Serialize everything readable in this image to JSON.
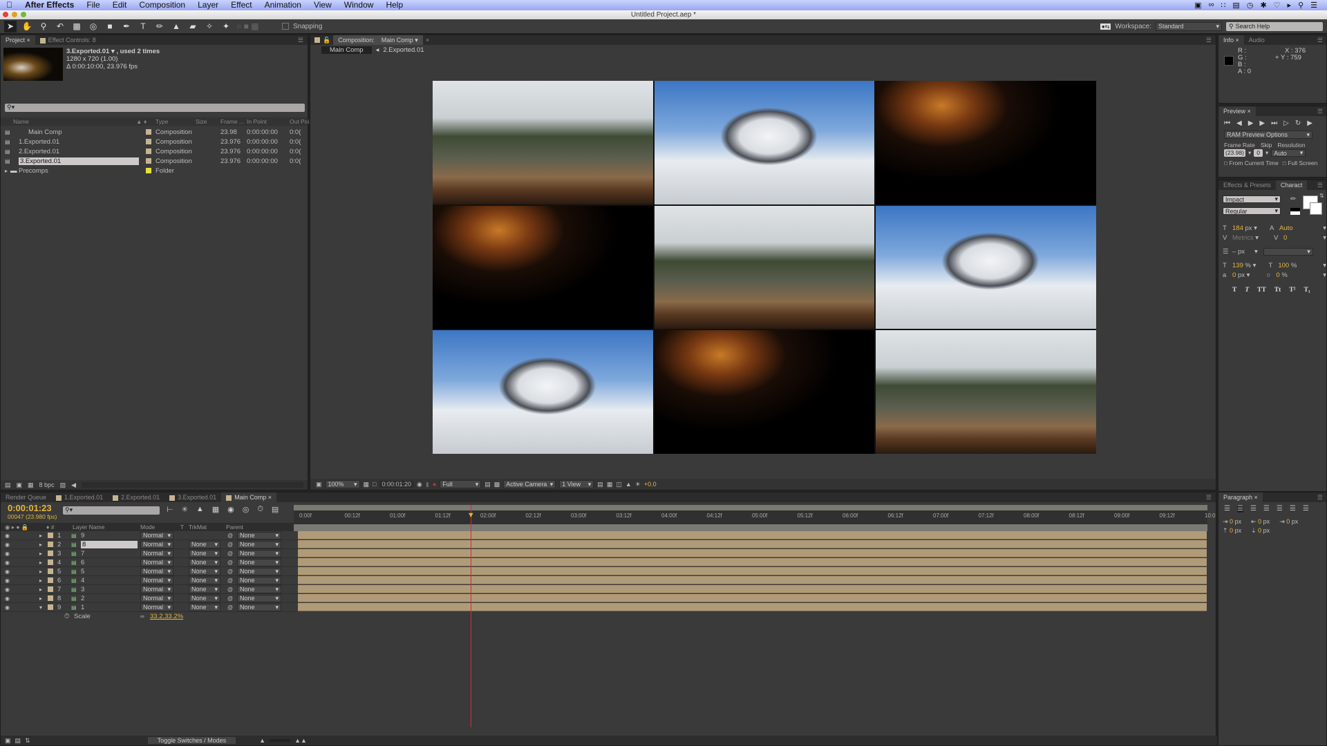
{
  "menubar": {
    "app": "After Effects",
    "items": [
      "File",
      "Edit",
      "Composition",
      "Layer",
      "Effect",
      "Animation",
      "View",
      "Window",
      "Help"
    ],
    "tray_icons": [
      "camera-icon",
      "creative-cloud-icon",
      "grid-icon",
      "folder-check-icon",
      "time-machine-icon",
      "bluetooth-icon",
      "wifi-icon",
      "volume-icon",
      "spotlight-icon",
      "list-icon"
    ]
  },
  "window": {
    "title": "Untitled Project.aep *"
  },
  "toolbar": {
    "snapping_label": "Snapping",
    "workspace_label": "Workspace:",
    "workspace_value": "Standard",
    "search_placeholder": "Search Help"
  },
  "project": {
    "tabs": [
      "Project",
      "Effect Controls: 8"
    ],
    "selected_name": "3.Exported.01 ▾ , used 2 times",
    "dimensions": "1280 x 720 (1.00)",
    "duration": "Δ 0:00:10:00, 23.976 fps",
    "search_placeholder": "",
    "columns": [
      "Name",
      "Type",
      "Size",
      "Frame ...",
      "In Point",
      "Out Poin"
    ],
    "items": [
      {
        "name": "Main Comp",
        "type": "Composition",
        "size": "",
        "frame": "23.98",
        "in": "0:00:00:00",
        "out": "0:0(",
        "selected": false
      },
      {
        "name": "1.Exported.01",
        "type": "Composition",
        "size": "",
        "frame": "23.976",
        "in": "0:00:00:00",
        "out": "0:0(",
        "selected": false
      },
      {
        "name": "2.Exported.01",
        "type": "Composition",
        "size": "",
        "frame": "23.976",
        "in": "0:00:00:00",
        "out": "0:0(",
        "selected": false
      },
      {
        "name": "3.Exported.01",
        "type": "Composition",
        "size": "",
        "frame": "23.976",
        "in": "0:00:00:00",
        "out": "0:0(",
        "selected": true
      },
      {
        "name": "Precomps",
        "type": "Folder",
        "size": "",
        "frame": "",
        "in": "",
        "out": "",
        "selected": false
      }
    ],
    "bpc": "8 bpc"
  },
  "composition": {
    "tab_label": "Composition:",
    "comp_name": "Main Comp",
    "breadcrumb": [
      "Main Comp",
      "2.Exported.01"
    ],
    "zoom": "100%",
    "timecode": "0:00:01:20",
    "resolution": "Full",
    "camera": "Active Camera",
    "views": "1 View",
    "exposure": "+0.0",
    "grid": [
      [
        "bmx",
        "mountain",
        "hand"
      ],
      [
        "hand",
        "bmx",
        "mountain"
      ],
      [
        "mountain",
        "hand",
        "bmx"
      ]
    ]
  },
  "info": {
    "tabs": [
      "Info",
      "Audio"
    ],
    "r": "R :",
    "g": "G :",
    "b": "B :",
    "a": "A : 0",
    "x": "X : 376",
    "y": "Y : 759"
  },
  "preview": {
    "tab": "Preview",
    "ram_options": "RAM Preview Options",
    "frame_rate_label": "Frame Rate",
    "skip_label": "Skip",
    "resolution_label": "Resolution",
    "frame_rate": "(23.98)",
    "skip": "0",
    "resolution": "Auto",
    "from_current": "From Current Time",
    "full_screen": "Full Screen"
  },
  "character": {
    "tabs": [
      "Effects & Presets",
      "Charact"
    ],
    "font": "Impact",
    "style": "Regular",
    "size": "184",
    "size_unit": "px",
    "leading": "Auto",
    "kerning": "Metrics",
    "tracking": "0",
    "line": "–",
    "line_unit": "px",
    "vscale": "139",
    "hscale": "100",
    "baseline": "0",
    "baseline_unit": "px",
    "tsume": "0",
    "styles": [
      "T",
      "T",
      "TT",
      "Tt",
      "T²",
      "T₁"
    ]
  },
  "paragraph": {
    "tab": "Paragraph",
    "indent_left": "0",
    "indent_right": "0",
    "indent_first": "0",
    "space_before": "0",
    "space_after": "0",
    "unit": "px"
  },
  "timeline": {
    "tabs": [
      "Render Queue",
      "1.Exported.01",
      "2.Exported.01",
      "3.Exported.01",
      "Main Comp"
    ],
    "timecode": "0:00:01:23",
    "frames": "00047 (23.980 fps)",
    "columns": [
      "Layer Name",
      "Mode",
      "T",
      "TrkMat",
      "Parent"
    ],
    "layers": [
      {
        "num": "1",
        "name": "9",
        "mode": "Normal",
        "trkmat": "",
        "parent": "None",
        "expanded": false
      },
      {
        "num": "2",
        "name": "8",
        "mode": "Normal",
        "trkmat": "None",
        "parent": "None",
        "expanded": false,
        "editing": true
      },
      {
        "num": "3",
        "name": "7",
        "mode": "Normal",
        "trkmat": "None",
        "parent": "None",
        "expanded": false
      },
      {
        "num": "4",
        "name": "6",
        "mode": "Normal",
        "trkmat": "None",
        "parent": "None",
        "expanded": false
      },
      {
        "num": "5",
        "name": "5",
        "mode": "Normal",
        "trkmat": "None",
        "parent": "None",
        "expanded": false
      },
      {
        "num": "6",
        "name": "4",
        "mode": "Normal",
        "trkmat": "None",
        "parent": "None",
        "expanded": false
      },
      {
        "num": "7",
        "name": "3",
        "mode": "Normal",
        "trkmat": "None",
        "parent": "None",
        "expanded": false
      },
      {
        "num": "8",
        "name": "2",
        "mode": "Normal",
        "trkmat": "None",
        "parent": "None",
        "expanded": false
      },
      {
        "num": "9",
        "name": "1",
        "mode": "Normal",
        "trkmat": "None",
        "parent": "None",
        "expanded": true
      }
    ],
    "property": {
      "name": "Scale",
      "value": "33.2,33.2%"
    },
    "ruler": [
      "0:00f",
      "00:12f",
      "01:00f",
      "01:12f",
      "02:00f",
      "02:12f",
      "03:00f",
      "03:12f",
      "04:00f",
      "04:12f",
      "05:00f",
      "05:12f",
      "06:00f",
      "06:12f",
      "07:00f",
      "07:12f",
      "08:00f",
      "08:12f",
      "09:00f",
      "09:12f",
      "10:0"
    ],
    "playhead_fraction": 0.19,
    "toggle_label": "Toggle Switches / Modes"
  },
  "colors": {
    "accent": "#e7b63a",
    "label": "#c6b491",
    "folder": "#e8e03a",
    "layer_bar": "#b09b78",
    "playhead": "#d8263a"
  }
}
